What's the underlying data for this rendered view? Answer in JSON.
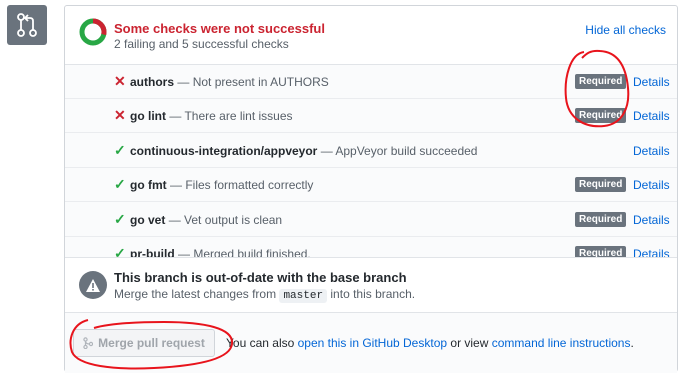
{
  "header": {
    "title": "Some checks were not successful",
    "subtitle": "2 failing and 5 successful checks",
    "hide_link": "Hide all checks"
  },
  "checks": [
    {
      "status": "fail",
      "name": "authors",
      "desc": "Not present in AUTHORS",
      "required": true,
      "details": "Details"
    },
    {
      "status": "fail",
      "name": "go lint",
      "desc": "There are lint issues",
      "required": true,
      "details": "Details"
    },
    {
      "status": "ok",
      "name": "continuous-integration/appveyor",
      "desc": "AppVeyor build succeeded",
      "required": false,
      "details": "Details"
    },
    {
      "status": "ok",
      "name": "go fmt",
      "desc": "Files formatted correctly",
      "required": true,
      "details": "Details"
    },
    {
      "status": "ok",
      "name": "go vet",
      "desc": "Vet output is clean",
      "required": true,
      "details": "Details"
    },
    {
      "status": "ok",
      "name": "pr-build",
      "desc": "Merged build finished.",
      "required": true,
      "details": "Details"
    }
  ],
  "labels": {
    "required": "Required",
    "dash": "—",
    "fail_icon": "✕",
    "ok_icon": "✓"
  },
  "branch": {
    "title": "This branch is out-of-date with the base branch",
    "sub_before": "Merge the latest changes from",
    "branch_name": "master",
    "sub_after": "into this branch."
  },
  "merge": {
    "button_label": "Merge pull request",
    "alt_before": "You can also",
    "desktop_link": "open this in GitHub Desktop",
    "alt_middle": "or view",
    "cli_link": "command line instructions",
    "alt_after": "."
  },
  "icons": {
    "tile": "git-pull-request-icon",
    "donut": "check-summary-donut-icon",
    "warning": "warning-icon",
    "merge": "git-merge-icon"
  },
  "colors": {
    "fail": "#cb2431",
    "success": "#28a745",
    "link": "#0366d6",
    "badge": "#6a737d",
    "annotation": "#e8141c"
  },
  "summary": {
    "failing": 2,
    "successful": 5
  }
}
